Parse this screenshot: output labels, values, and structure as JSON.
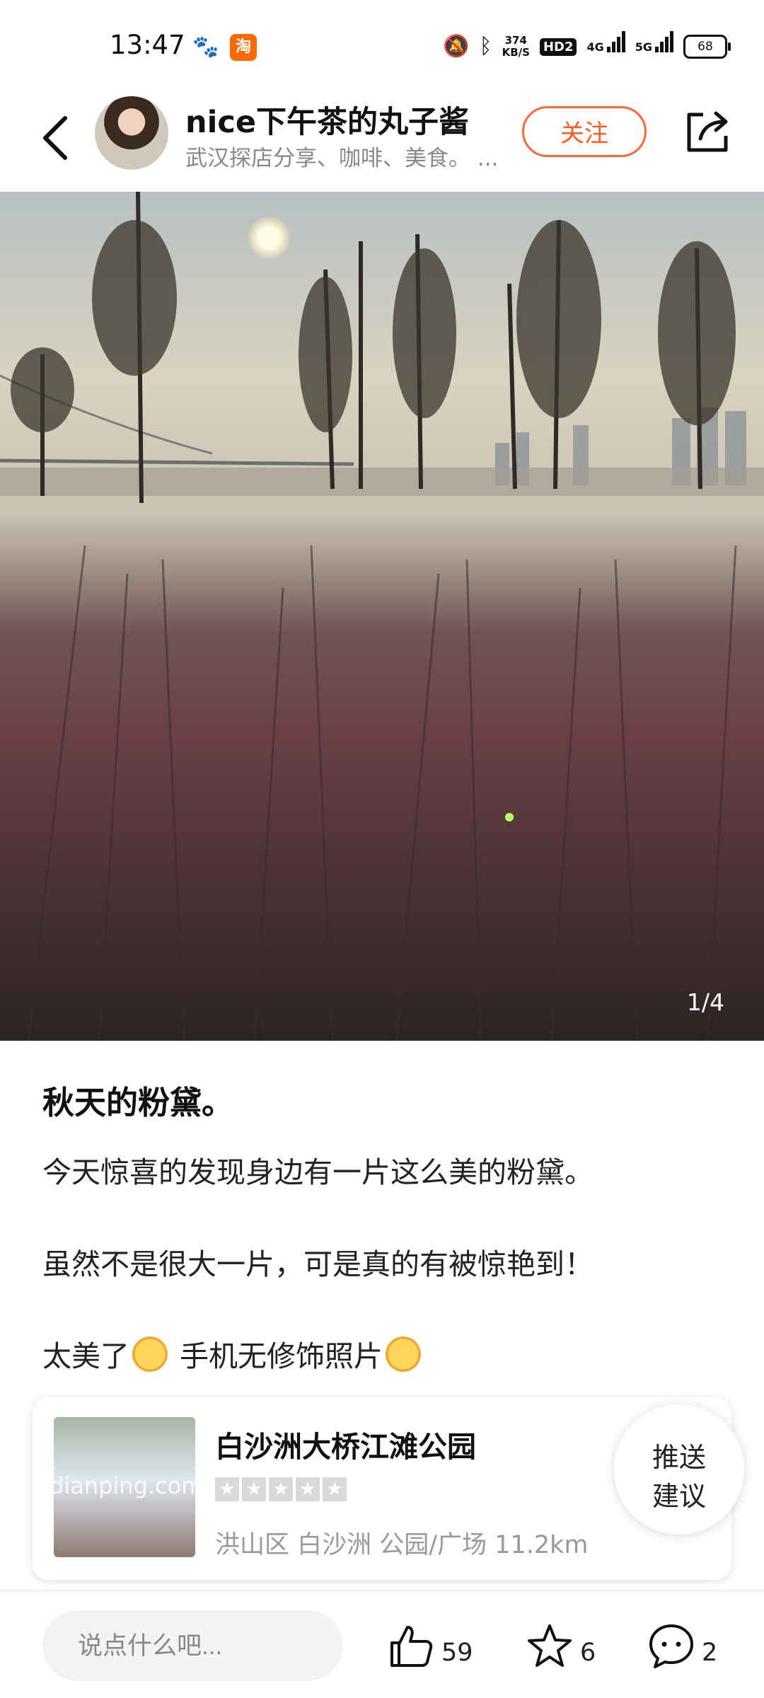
{
  "status_bar": {
    "time": "13:47",
    "apps": [
      "baidu-icon",
      "taobao-icon"
    ],
    "taobao_label": "淘",
    "net_speed_value": "374",
    "net_speed_unit": "KB/S",
    "hd_badge": "HD2",
    "signal1_label": "4G",
    "signal2_label": "5G",
    "battery": "68"
  },
  "header": {
    "author_name": "nice下午茶的丸子酱",
    "author_bio": "武汉探店分享、咖啡、美食。 ...",
    "follow_label": "关注"
  },
  "photo": {
    "counter": "1/4"
  },
  "post": {
    "title": "秋天的粉黛。",
    "line1": "今天惊喜的发现身边有一片这么美的粉黛。",
    "line2": "虽然不是很大一片，可是真的有被惊艳到！",
    "line3_a": "太美了",
    "line3_b": " 手机无修饰照片"
  },
  "place": {
    "thumb_watermark": "dianping.com",
    "name": "白沙洲大桥江滩公园",
    "rating": 0,
    "meta": "洪山区 白沙洲 公园/广场   11.2km"
  },
  "suggest": {
    "line1": "推送",
    "line2": "建议"
  },
  "bottom_bar": {
    "comment_placeholder": "说点什么吧...",
    "like_count": "59",
    "favorite_count": "6",
    "comment_count": "2"
  }
}
